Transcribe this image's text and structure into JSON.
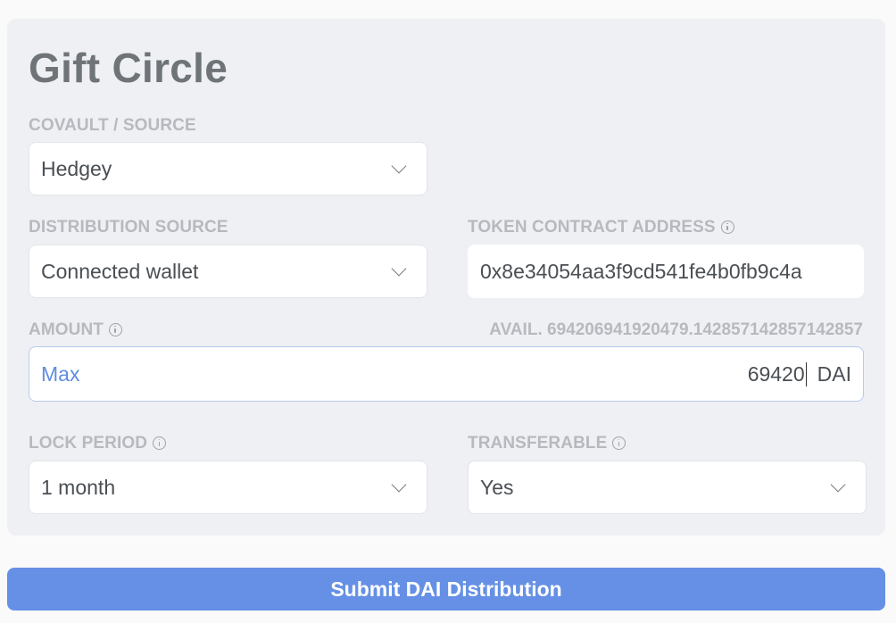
{
  "title": "Gift Circle",
  "covault": {
    "label": "COVAULT / SOURCE",
    "value": "Hedgey"
  },
  "distribution_source": {
    "label": "DISTRIBUTION SOURCE",
    "value": "Connected wallet"
  },
  "token_contract": {
    "label": "TOKEN CONTRACT ADDRESS",
    "value": "0x8e34054aa3f9cd541fe4b0fb9c4a"
  },
  "amount": {
    "label": "AMOUNT",
    "available": "AVAIL. 694206941920479.142857142857142857",
    "max_label": "Max",
    "value": "69420",
    "unit": "DAI"
  },
  "lock_period": {
    "label": "LOCK PERIOD",
    "value": "1 month"
  },
  "transferable": {
    "label": "TRANSFERABLE",
    "value": "Yes"
  },
  "submit_label": "Submit DAI Distribution",
  "colors": {
    "accent": "#6590e5",
    "card_bg": "#eff0f4",
    "label": "#b6b9be"
  },
  "icons": [
    "info-icon",
    "chevron-down-icon"
  ]
}
